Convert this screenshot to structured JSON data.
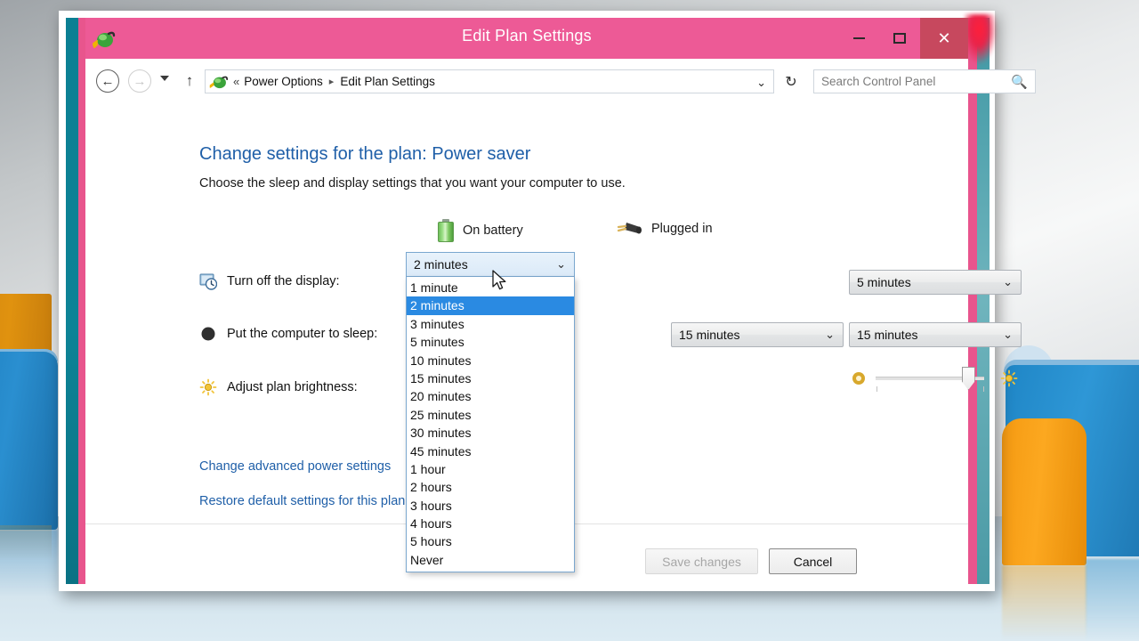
{
  "window": {
    "title": "Edit Plan Settings",
    "title_icon": "power-plug-icon",
    "minimize_label": "Minimize",
    "maximize_label": "Maximize",
    "close_label": "✕"
  },
  "nav": {
    "back_glyph": "←",
    "forward_glyph": "→",
    "up_glyph": "↑",
    "recent_glyph": "▾",
    "refresh_glyph": "↻",
    "address_icon": "power-options-icon",
    "address_prefix": "«",
    "crumb1": "Power Options",
    "crumb_sep": "▸",
    "crumb2": "Edit Plan Settings",
    "address_caret": "⌄"
  },
  "search": {
    "placeholder": "Search Control Panel",
    "icon": "🔍"
  },
  "main": {
    "heading": "Change settings for the plan: Power saver",
    "subheading": "Choose the sleep and display settings that you want your computer to use.",
    "columns": [
      {
        "label": "On battery",
        "icon": "battery-icon"
      },
      {
        "label": "Plugged in",
        "icon": "power-plug-icon"
      }
    ],
    "rows": [
      {
        "label": "Turn off the display:",
        "icon": "display-clock-icon",
        "battery_value": "2 minutes",
        "plugged_value": "5 minutes"
      },
      {
        "label": "Put the computer to sleep:",
        "icon": "sleep-moon-icon",
        "battery_value": "",
        "plugged_value": "15 minutes"
      },
      {
        "label": "Adjust plan brightness:",
        "icon": "brightness-sun-icon",
        "battery_value": "",
        "plugged_value": ""
      }
    ],
    "sleep_battery_value": "15 minutes",
    "brightness": {
      "low_icon": "dim-icon",
      "high_icon": "bright-icon",
      "value_percent": 85
    },
    "links": [
      "Change advanced power settings",
      "Restore default settings for this plan"
    ]
  },
  "dropdown": {
    "open": true,
    "selected": "2 minutes",
    "highlight_color": "#2a8ae2",
    "options": [
      "1 minute",
      "2 minutes",
      "3 minutes",
      "5 minutes",
      "10 minutes",
      "15 minutes",
      "20 minutes",
      "25 minutes",
      "30 minutes",
      "45 minutes",
      "1 hour",
      "2 hours",
      "3 hours",
      "4 hours",
      "5 hours",
      "Never"
    ]
  },
  "footer": {
    "save_label": "Save changes",
    "save_enabled": false,
    "cancel_label": "Cancel"
  },
  "colors": {
    "titlebar": "#ed5a96",
    "close_button": "#c7485e",
    "link": "#1f5fa8",
    "heading": "#1f5fa8",
    "frame_teal": "#0d8396"
  }
}
